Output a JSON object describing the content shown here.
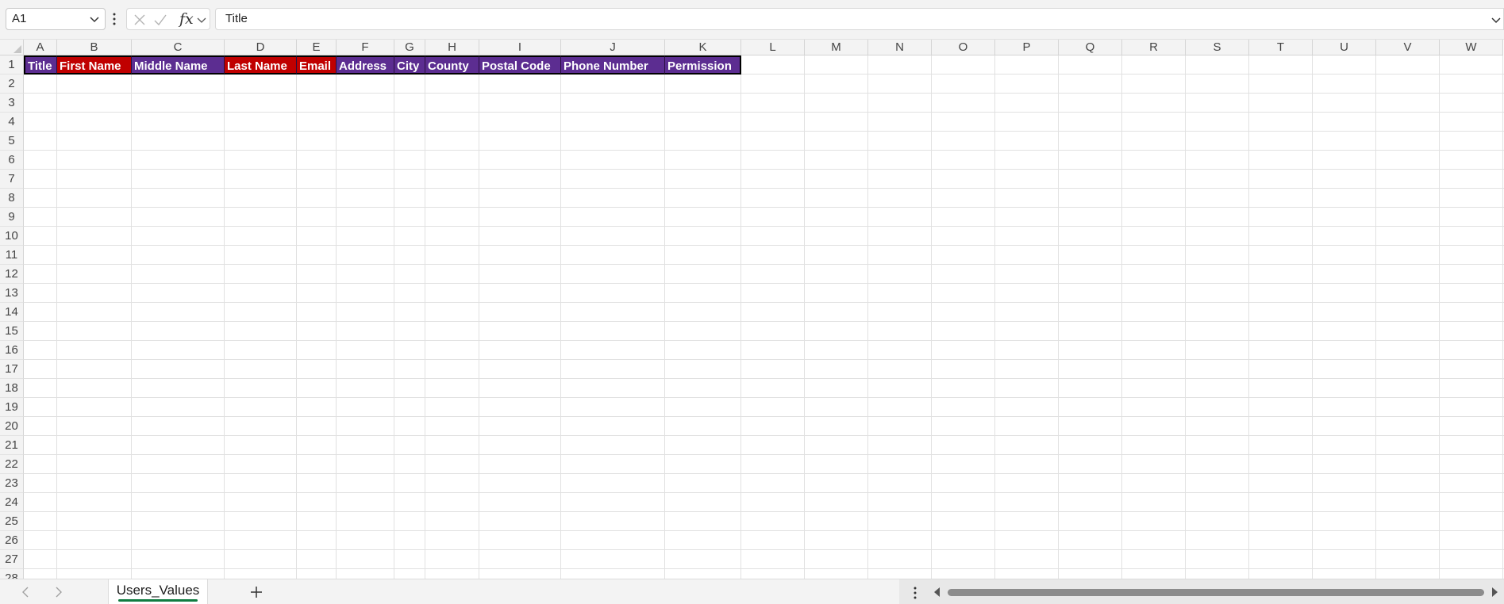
{
  "formula_bar": {
    "name_box": "A1",
    "fx_label": "fx",
    "formula_value": "Title"
  },
  "columns": [
    "A",
    "B",
    "C",
    "D",
    "E",
    "F",
    "G",
    "H",
    "I",
    "J",
    "K",
    "L",
    "M",
    "N",
    "O",
    "P",
    "Q",
    "R",
    "S",
    "T",
    "U",
    "V",
    "W"
  ],
  "rows": [
    "1",
    "2",
    "3",
    "4",
    "5",
    "6",
    "7",
    "8",
    "9",
    "10",
    "11",
    "12",
    "13",
    "14",
    "15",
    "16",
    "17",
    "18",
    "19",
    "20",
    "21",
    "22",
    "23",
    "24",
    "25",
    "26",
    "27",
    "28"
  ],
  "header_row": {
    "cells": [
      {
        "text": "Title",
        "color": "#5c2d91"
      },
      {
        "text": "First Name",
        "color": "#c00000"
      },
      {
        "text": "Middle Name",
        "color": "#5c2d91"
      },
      {
        "text": "Last Name",
        "color": "#c00000"
      },
      {
        "text": "Email",
        "color": "#c00000"
      },
      {
        "text": "Address",
        "color": "#5c2d91"
      },
      {
        "text": "City",
        "color": "#5c2d91"
      },
      {
        "text": "County",
        "color": "#5c2d91"
      },
      {
        "text": "Postal Code",
        "color": "#5c2d91"
      },
      {
        "text": "Phone Number",
        "color": "#5c2d91"
      },
      {
        "text": "Permission",
        "color": "#5c2d91"
      }
    ]
  },
  "sheet_tabs": {
    "active": "Users_Values"
  },
  "colors": {
    "accent_green": "#107c41",
    "purple_header": "#5c2d91",
    "red_header": "#c00000"
  }
}
